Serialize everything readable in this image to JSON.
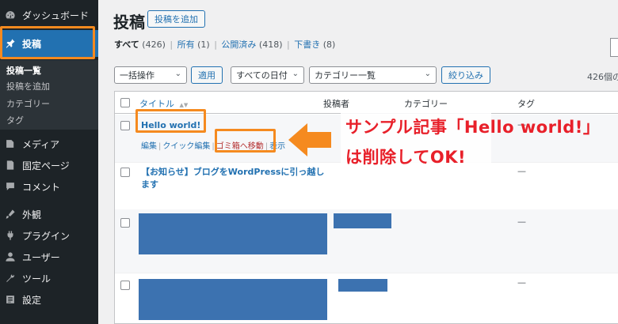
{
  "sidebar": {
    "items": [
      {
        "label": "ダッシュボード",
        "icon": "dashboard-icon"
      },
      {
        "label": "投稿",
        "icon": "pin-icon",
        "active": true
      },
      {
        "label": "メディア",
        "icon": "media-icon"
      },
      {
        "label": "固定ページ",
        "icon": "page-icon"
      },
      {
        "label": "コメント",
        "icon": "comment-icon"
      },
      {
        "label": "外観",
        "icon": "brush-icon"
      },
      {
        "label": "プラグイン",
        "icon": "plugin-icon"
      },
      {
        "label": "ユーザー",
        "icon": "user-icon"
      },
      {
        "label": "ツール",
        "icon": "wrench-icon"
      },
      {
        "label": "設定",
        "icon": "settings-icon"
      }
    ],
    "submenu": [
      "投稿一覧",
      "投稿を追加",
      "カテゴリー",
      "タグ"
    ]
  },
  "header": {
    "title": "投稿",
    "add_button": "投稿を追加"
  },
  "filters": {
    "all": "すべて",
    "all_count": "(426)",
    "mine": "所有",
    "mine_count": "(1)",
    "published": "公開済み",
    "published_count": "(418)",
    "drafts": "下書き",
    "drafts_count": "(8)",
    "separator": "|"
  },
  "toolbar": {
    "bulk_action": "一括操作",
    "apply": "適用",
    "dates": "すべての日付",
    "category": "カテゴリー一覧",
    "filter": "絞り込み",
    "items_count": "426個の"
  },
  "table": {
    "headers": {
      "title": "タイトル",
      "sort": "▲▼",
      "author": "投稿者",
      "categories": "カテゴリー",
      "tags": "タグ"
    },
    "rows": [
      {
        "title": "Hello world!",
        "tags": "—",
        "actions": {
          "edit": "編集",
          "quick_edit": "クイック編集",
          "trash": "ゴミ箱へ移動",
          "view": "表示"
        }
      },
      {
        "title": "【お知らせ】ブログをWordPressに引っ越します",
        "tags": "—"
      },
      {
        "tags": "—"
      },
      {
        "tags": "—"
      }
    ]
  },
  "annotation": {
    "line1": "サンプル記事「Hello world!」",
    "line2": "は削除してOK!",
    "highlight_color": "#f58a1f",
    "text_color": "#e8202a"
  }
}
